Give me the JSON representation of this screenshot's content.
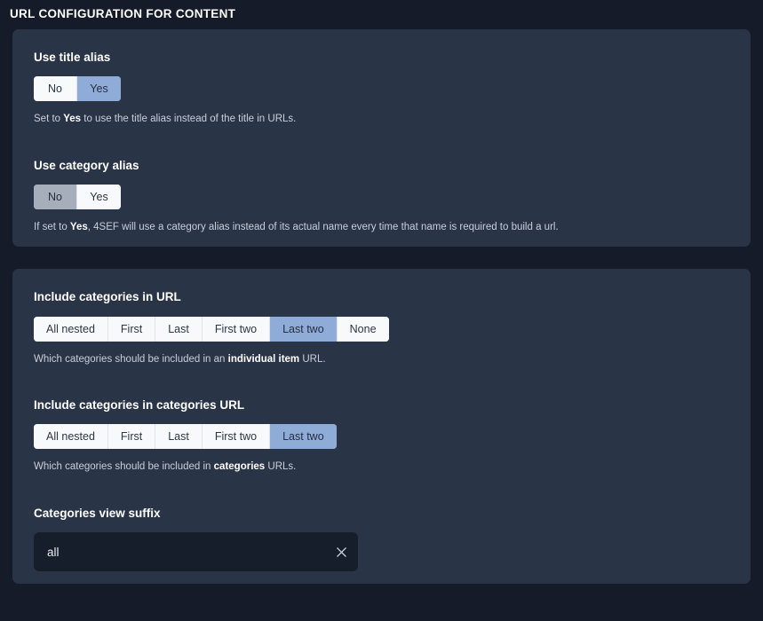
{
  "header": {
    "title": "URL CONFIGURATION FOR CONTENT"
  },
  "colors": {
    "page_background": "#151b28",
    "card_background": "#2a3447",
    "active_blue": "#8fabd8",
    "active_gray": "#a5aeba",
    "button_idle": "#f7f9fb",
    "input_background": "#161d2b",
    "label_text": "#ffffff",
    "help_text": "#c8cfdb"
  },
  "cards": [
    {
      "fields": [
        {
          "label": "Use title alias",
          "control": "button-group",
          "options": [
            "No",
            "Yes"
          ],
          "selected": "Yes",
          "selected_style": "active-blue",
          "help": {
            "prefix": "Set to ",
            "strong": "Yes",
            "suffix": " to use the title alias instead of the title in URLs."
          }
        },
        {
          "label": "Use category alias",
          "control": "button-group",
          "options": [
            "No",
            "Yes"
          ],
          "selected": "No",
          "selected_style": "active-gray",
          "help": {
            "prefix": "If set to ",
            "strong": "Yes",
            "suffix": ", 4SEF will use a category alias instead of its actual name every time that name is required to build a url."
          }
        }
      ]
    },
    {
      "fields": [
        {
          "label": "Include categories in URL",
          "control": "button-group",
          "options": [
            "All nested",
            "First",
            "Last",
            "First two",
            "Last two",
            "None"
          ],
          "selected": "Last two",
          "selected_style": "active-blue",
          "help": {
            "prefix": "Which categories should be included in an ",
            "strong": "individual item",
            "suffix": " URL."
          }
        },
        {
          "label": "Include categories in categories URL",
          "control": "button-group",
          "options": [
            "All nested",
            "First",
            "Last",
            "First two",
            "Last two"
          ],
          "selected": "Last two",
          "selected_style": "active-blue",
          "help": {
            "prefix": "Which categories should be included in ",
            "strong": "categories",
            "suffix": " URLs."
          }
        },
        {
          "label": "Categories view suffix",
          "control": "text-input",
          "value": "all",
          "placeholder": "",
          "clear_icon": "close-icon"
        }
      ]
    }
  ]
}
